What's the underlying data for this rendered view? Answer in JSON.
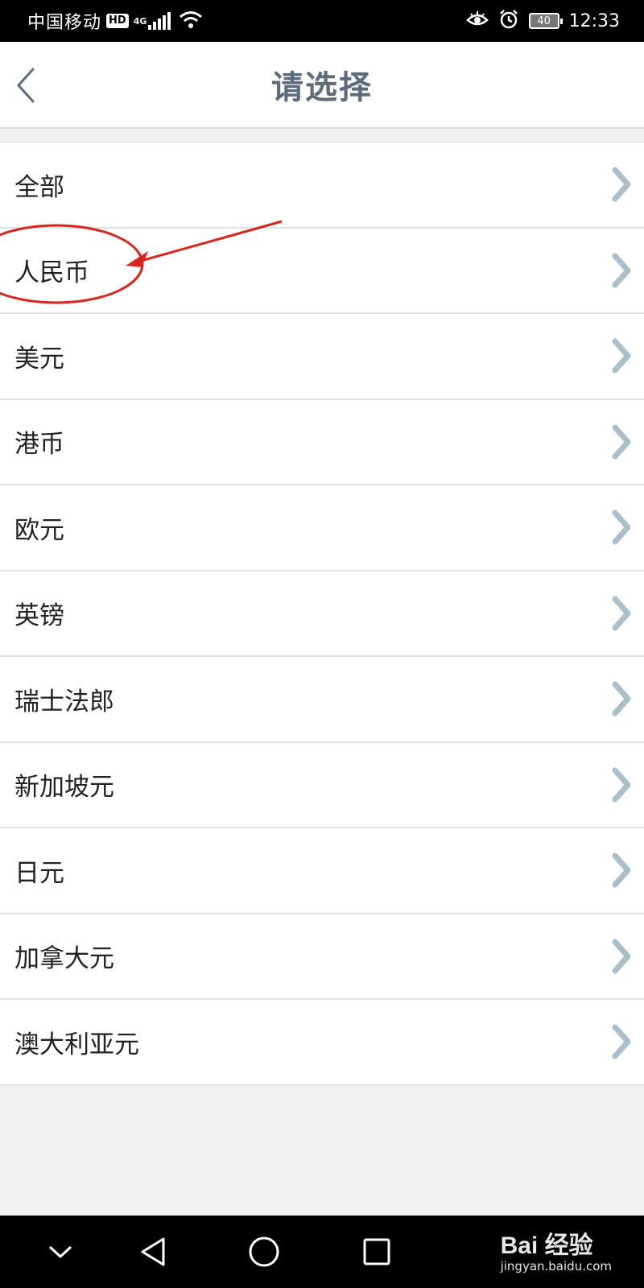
{
  "status_bar": {
    "carrier": "中国移动",
    "hd_badge": "HD",
    "network_type": "4G",
    "battery_level": "40",
    "time": "12:33"
  },
  "header": {
    "title": "请选择"
  },
  "currency_list": [
    {
      "label": "全部"
    },
    {
      "label": "人民币"
    },
    {
      "label": "美元"
    },
    {
      "label": "港币"
    },
    {
      "label": "欧元"
    },
    {
      "label": "英镑"
    },
    {
      "label": "瑞士法郎"
    },
    {
      "label": "新加坡元"
    },
    {
      "label": "日元"
    },
    {
      "label": "加拿大元"
    },
    {
      "label": "澳大利亚元"
    }
  ],
  "watermark": {
    "logo": "Bai 经验",
    "url": "jingyan.baidu.com"
  },
  "colors": {
    "title": "#5d6b7a",
    "chevron": "#a9bfcb",
    "annotation": "#d9251c",
    "background": "#f0f0f0"
  }
}
